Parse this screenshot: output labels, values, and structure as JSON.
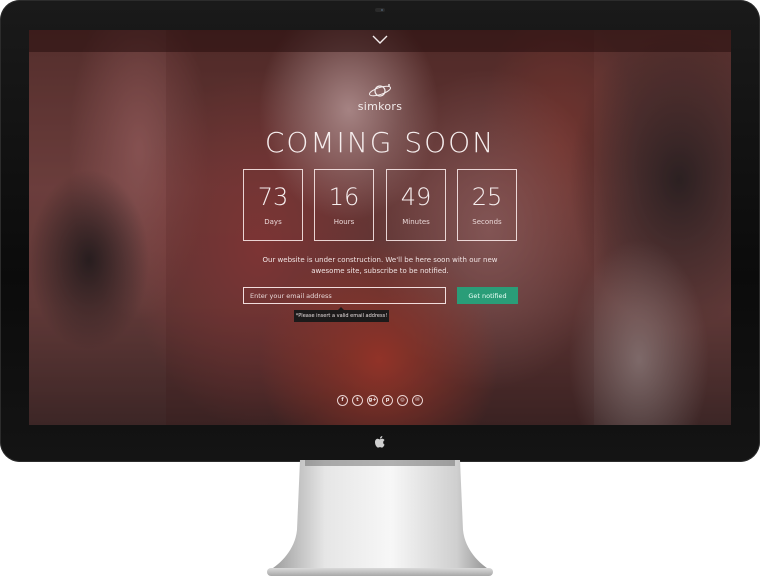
{
  "brand": {
    "name": "simkors"
  },
  "headline": "COMING SOON",
  "countdown": [
    {
      "value": "73",
      "label": "Days"
    },
    {
      "value": "16",
      "label": "Hours"
    },
    {
      "value": "49",
      "label": "Minutes"
    },
    {
      "value": "25",
      "label": "Seconds"
    }
  ],
  "description": "Our website is under construction. We'll be here soon with our new awesome site, subscribe to be notified.",
  "subscribe": {
    "placeholder": "Enter your email address",
    "button_label": "Get notified",
    "error": "*Please insert a valid email address!"
  },
  "social": [
    {
      "icon": "facebook-icon",
      "glyph": "f"
    },
    {
      "icon": "twitter-icon",
      "glyph": "t"
    },
    {
      "icon": "google-plus-icon",
      "glyph": "g+"
    },
    {
      "icon": "pinterest-icon",
      "glyph": "p"
    },
    {
      "icon": "dribbble-icon",
      "glyph": "◎"
    },
    {
      "icon": "email-icon",
      "glyph": "✉"
    }
  ],
  "colors": {
    "accent": "#2a9d78",
    "text": "#f6eeee"
  }
}
